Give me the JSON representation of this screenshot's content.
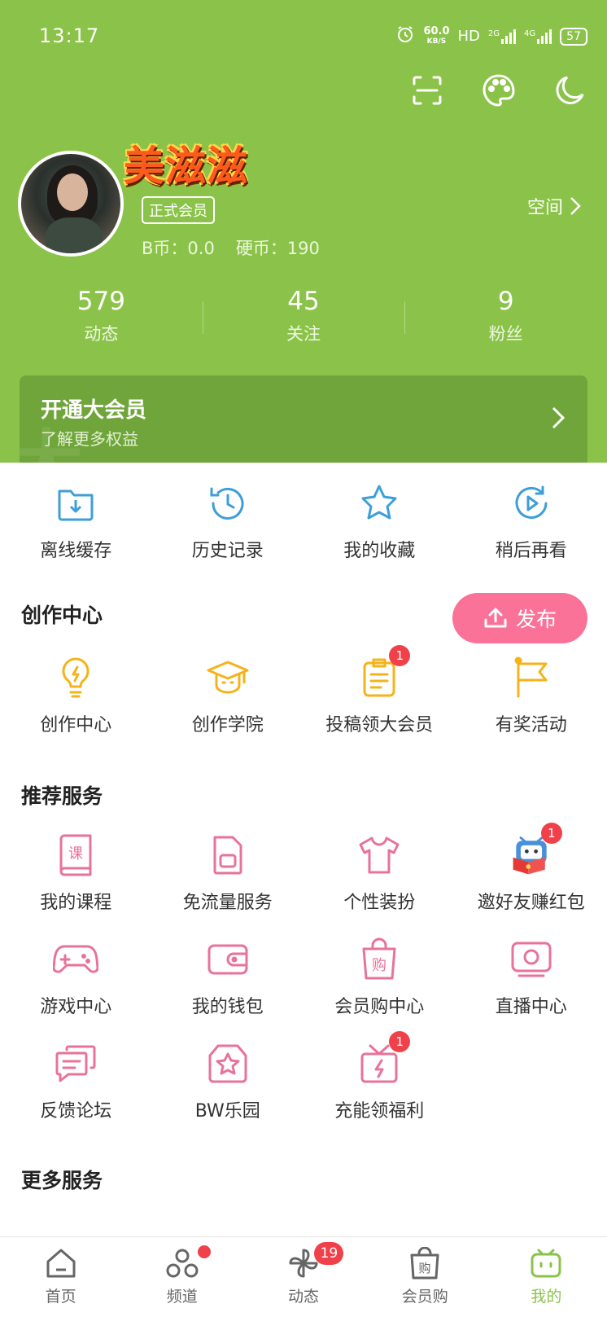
{
  "status_bar": {
    "time": "13:17",
    "net_speed_value": "60.0",
    "net_speed_unit": "KB/S",
    "hd": "HD",
    "signal_1": "2G",
    "signal_2": "4G",
    "battery": "57"
  },
  "profile": {
    "username": "美滋滋",
    "member_tag": "正式会员",
    "b_coins": "B币：0.0",
    "hard_coins": "硬币：190",
    "space_label": "空间"
  },
  "stats": [
    {
      "value": "579",
      "label": "动态"
    },
    {
      "value": "45",
      "label": "关注"
    },
    {
      "value": "9",
      "label": "粉丝"
    }
  ],
  "vip_banner": {
    "title": "开通大会员",
    "subtitle": "了解更多权益"
  },
  "quick_actions": [
    {
      "label": "离线缓存",
      "icon": "download-folder-icon"
    },
    {
      "label": "历史记录",
      "icon": "history-clock-icon"
    },
    {
      "label": "我的收藏",
      "icon": "star-icon"
    },
    {
      "label": "稍后再看",
      "icon": "watch-later-icon"
    }
  ],
  "creation": {
    "title": "创作中心",
    "publish_label": "发布",
    "items": [
      {
        "label": "创作中心",
        "icon": "lightbulb-icon"
      },
      {
        "label": "创作学院",
        "icon": "graduation-cap-icon"
      },
      {
        "label": "投稿领大会员",
        "icon": "clipboard-icon",
        "badge": "1"
      },
      {
        "label": "有奖活动",
        "icon": "flag-icon"
      }
    ]
  },
  "recommended": {
    "title": "推荐服务",
    "items": [
      {
        "label": "我的课程",
        "icon": "course-book-icon",
        "glyph": "课"
      },
      {
        "label": "免流量服务",
        "icon": "sim-card-icon"
      },
      {
        "label": "个性装扮",
        "icon": "tshirt-icon"
      },
      {
        "label": "邀好友赚红包",
        "icon": "mascot-red-packet-icon",
        "badge": "1"
      },
      {
        "label": "游戏中心",
        "icon": "gamepad-icon"
      },
      {
        "label": "我的钱包",
        "icon": "wallet-icon"
      },
      {
        "label": "会员购中心",
        "icon": "shopping-bag-icon",
        "glyph": "购"
      },
      {
        "label": "直播中心",
        "icon": "live-tv-icon"
      },
      {
        "label": "反馈论坛",
        "icon": "chat-bubbles-icon"
      },
      {
        "label": "BW乐园",
        "icon": "star-badge-icon"
      },
      {
        "label": "充能领福利",
        "icon": "gift-bolt-icon",
        "badge": "1"
      }
    ]
  },
  "more_services": {
    "title": "更多服务"
  },
  "bottom_nav": [
    {
      "label": "首页",
      "icon": "home-icon"
    },
    {
      "label": "频道",
      "icon": "channel-icon",
      "dot": true
    },
    {
      "label": "动态",
      "icon": "pinwheel-icon",
      "badge": "19"
    },
    {
      "label": "会员购",
      "icon": "shopping-bag-icon",
      "glyph": "购"
    },
    {
      "label": "我的",
      "icon": "tv-mascot-icon",
      "active": true
    }
  ],
  "colors": {
    "header_green": "#8bc34a",
    "vip_banner": "#6fa53a",
    "icon_blue": "#3d9fd8",
    "icon_yellow": "#f5b31a",
    "icon_pink": "#e8739a",
    "publish_pink": "#fb7299",
    "badge_red": "#f0414a"
  }
}
